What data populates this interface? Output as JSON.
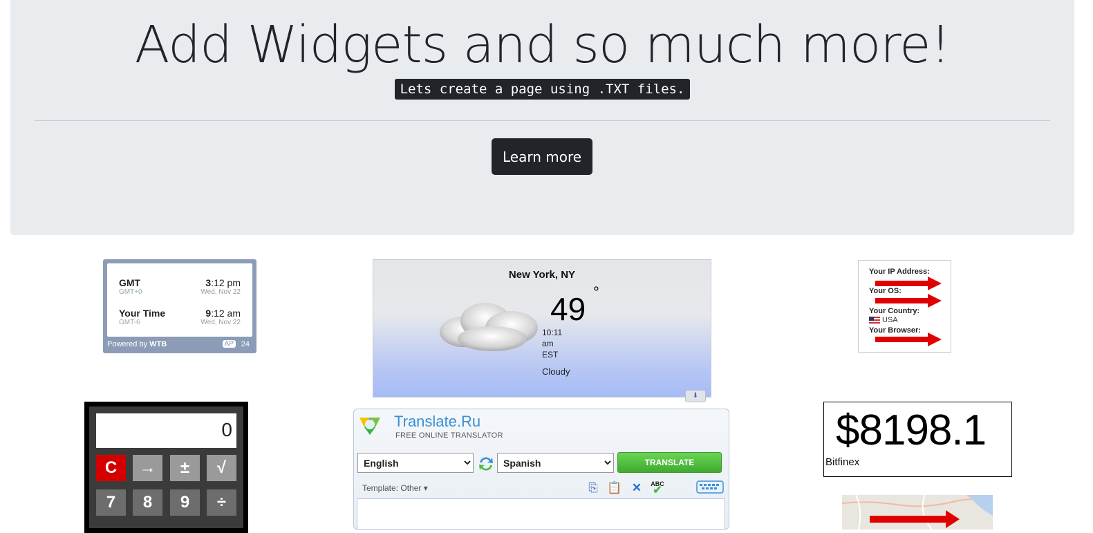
{
  "jumbotron": {
    "title": "Add Widgets and so much more!",
    "subtitle_code": "Lets create a page using .TXT files.",
    "button_label": "Learn more"
  },
  "world_time": {
    "rows": [
      {
        "zone": "GMT",
        "offset": "GMT+0",
        "hour": "3",
        "rest": ":12 pm",
        "date": "Wed, Nov 22"
      },
      {
        "zone": "Your Time",
        "offset": "GMT-6",
        "hour": "9",
        "rest": ":12 am",
        "date": "Wed, Nov 22"
      }
    ],
    "powered_prefix": "Powered by",
    "powered_brand": "WTB",
    "ap_label": "AP",
    "ap_number": "24"
  },
  "weather": {
    "city": "New York, NY",
    "temperature": "49",
    "degree_symbol": "°",
    "time_lines": [
      "10:11",
      "am",
      "EST"
    ],
    "condition": "Cloudy"
  },
  "ip_widget": {
    "labels": [
      "Your IP Address:",
      "Your OS:",
      "Your Country:",
      "Your Browser:"
    ],
    "country": "USA"
  },
  "calculator": {
    "display": "0",
    "keys_row1": [
      "C",
      "→",
      "±",
      "√"
    ],
    "keys_row2": [
      "7",
      "8",
      "9",
      "÷"
    ]
  },
  "translator": {
    "brand": "Translate.Ru",
    "tagline": "FREE ONLINE TRANSLATOR",
    "source_language": "English",
    "target_language": "Spanish",
    "translate_label": "TRANSLATE",
    "template_label": "Template: Other ▾",
    "spellcheck_label": "ABC"
  },
  "price_ticker": {
    "value": "$8198.1",
    "exchange": "Bitfinex"
  },
  "colors": {
    "jumbotron_bg": "#e9ecef",
    "dark": "#212529",
    "translate_green": "#4cbb3a",
    "brand_blue": "#3a8fd4",
    "calc_red": "#d40000"
  }
}
